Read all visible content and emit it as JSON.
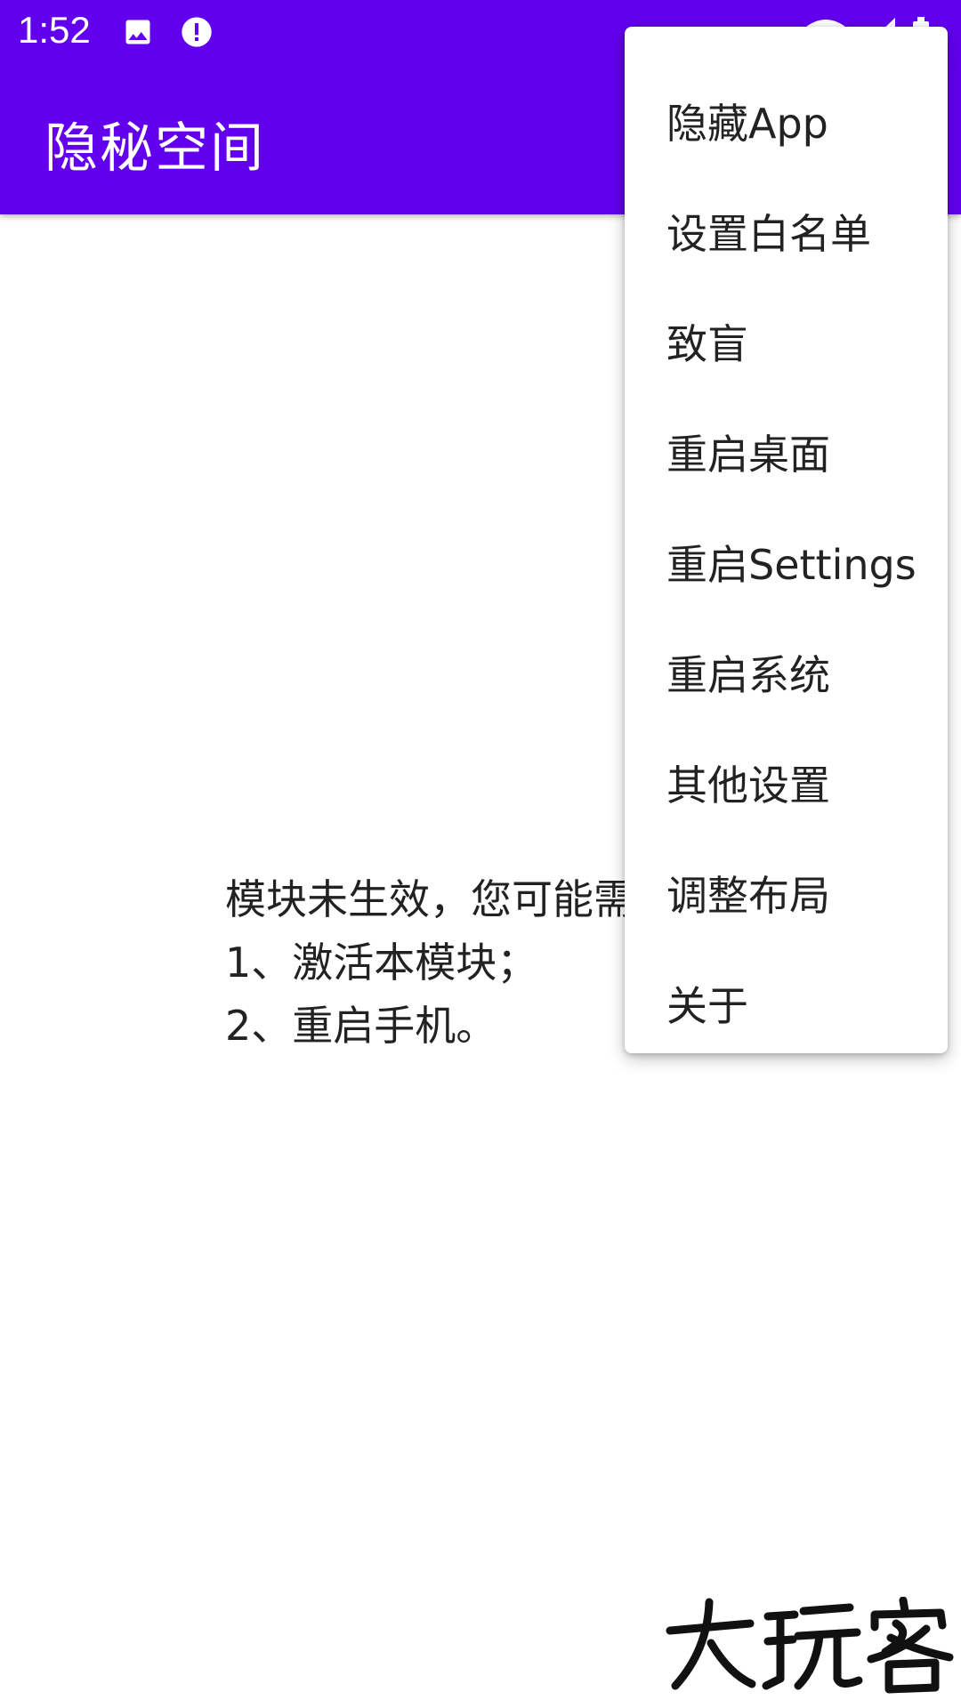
{
  "status_bar": {
    "time": "1:52",
    "background": "#6200EE"
  },
  "app_bar": {
    "title": "隐秘空间",
    "background": "#6200EE"
  },
  "content": {
    "message_lines": [
      "模块未生效，您可能需",
      "1、激活本模块；",
      "2、重启手机。"
    ]
  },
  "menu": {
    "items": [
      "隐藏App",
      "设置白名单",
      "致盲",
      "重启桌面",
      "重启Settings",
      "重启系统",
      "其他设置",
      "调整布局",
      "关于"
    ]
  },
  "watermark": {
    "text": "大玩客"
  },
  "icons": {
    "status_left": [
      "image-icon",
      "alert-icon"
    ],
    "status_right": [
      "wifi-icon",
      "signal-icon",
      "battery-icon"
    ]
  }
}
